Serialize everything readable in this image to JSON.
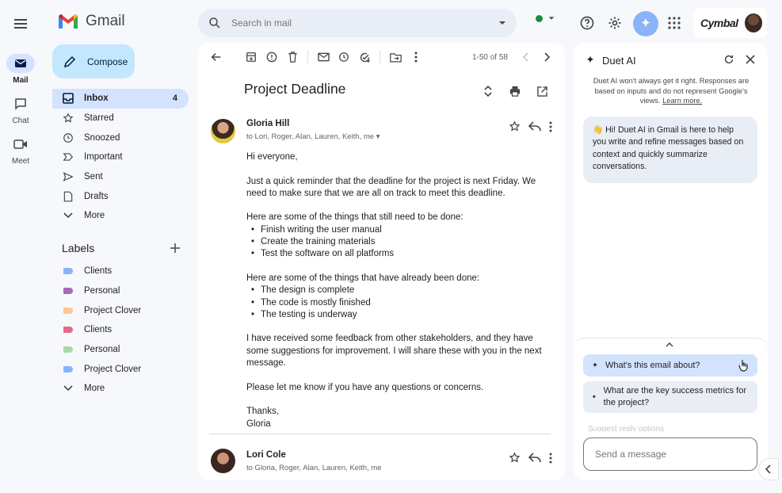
{
  "app": {
    "name": "Gmail"
  },
  "search": {
    "placeholder": "Search in mail"
  },
  "header": {
    "brand": "Cymbal"
  },
  "rail": [
    {
      "label": "Mail",
      "active": true
    },
    {
      "label": "Chat",
      "active": false
    },
    {
      "label": "Meet",
      "active": false
    }
  ],
  "compose": {
    "label": "Compose"
  },
  "nav": [
    {
      "label": "Inbox",
      "count": "4",
      "icon": "inbox-icon",
      "active": true
    },
    {
      "label": "Starred",
      "icon": "star-icon"
    },
    {
      "label": "Snoozed",
      "icon": "clock-icon"
    },
    {
      "label": "Important",
      "icon": "important-icon"
    },
    {
      "label": "Sent",
      "icon": "send-icon"
    },
    {
      "label": "Drafts",
      "icon": "draft-icon"
    },
    {
      "label": "More",
      "icon": "chevron-down-icon"
    }
  ],
  "labels": {
    "heading": "Labels",
    "items": [
      {
        "label": "Clients",
        "color": "#8ab4f8"
      },
      {
        "label": "Personal",
        "color": "#a66bb5"
      },
      {
        "label": "Project Clover",
        "color": "#fcc98c"
      },
      {
        "label": "Clients",
        "color": "#e06c8a"
      },
      {
        "label": "Personal",
        "color": "#a8d8a8"
      },
      {
        "label": "Project Clover",
        "color": "#8ab4f8"
      }
    ],
    "more": "More"
  },
  "toolbar": {
    "paging": "1-50 of 58"
  },
  "thread": {
    "subject": "Project Deadline",
    "messages": [
      {
        "sender": "Gloria Hill",
        "recipients": "to Lori, Roger, Alan, Lauren, Keith, me",
        "greeting": "Hi everyone,",
        "p1": "Just a quick reminder that the deadline for the project is next Friday. We need to make sure that we are all on track to meet this deadline.",
        "todo_intro": "Here are some of the things that still need to be done:",
        "todo": [
          "Finish writing the user manual",
          "Create the training materials",
          "Test the software on all platforms"
        ],
        "done_intro": "Here are some of the things that have already been done:",
        "done": [
          "The design is complete",
          "The code is mostly finished",
          "The testing is underway"
        ],
        "p2": "I have received some feedback from other stakeholders, and they have some suggestions for improvement. I will share these with you in the next message.",
        "p3": "Please let me know if you have any questions or concerns.",
        "signoff": "Thanks,",
        "signature": "Gloria"
      },
      {
        "sender": "Lori Cole",
        "recipients": "to Gloria, Roger, Alan, Lauren, Keith, me"
      }
    ]
  },
  "duet": {
    "title": "Duet AI",
    "disclaimer": "Duet AI won't always get it right. Responses are based on inputs and do not represent Google's views.",
    "learn_more": "Learn more.",
    "greeting": "👋 Hi! Duet AI in Gmail is here to help you write and refine messages based on context and quickly summarize conversations.",
    "suggestions": [
      "What's this email about?",
      "What are the key success metrics for the project?",
      "Suggest reply options"
    ],
    "input_placeholder": "Send a message"
  },
  "colors": {
    "accent": "#0b57d0",
    "compose_bg": "#c2e7ff",
    "active_nav": "#d3e3fd"
  }
}
